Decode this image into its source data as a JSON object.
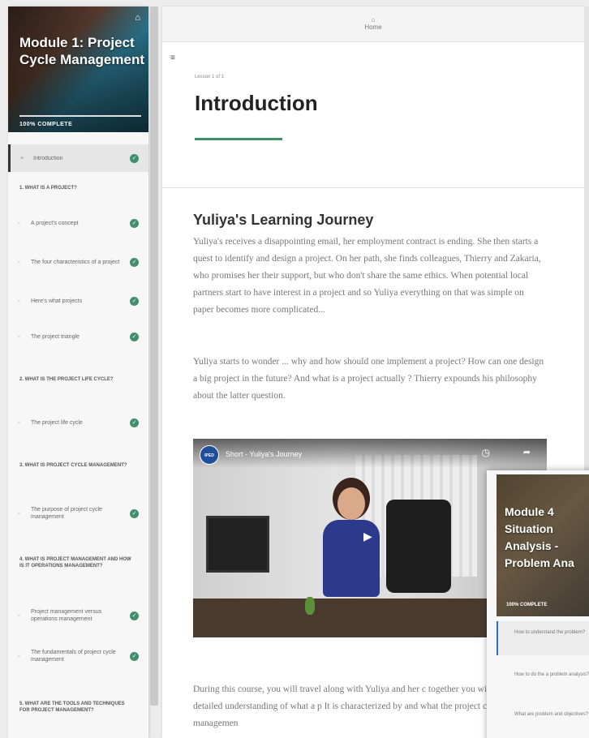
{
  "sidebar": {
    "hero_title": "Module 1: Project Cycle Management",
    "status": "100% COMPLETE",
    "items": [
      {
        "kind": "lesson",
        "label": "Introduction",
        "complete": true,
        "active": true
      },
      {
        "kind": "section",
        "label": "1. WHAT IS A PROJECT?"
      },
      {
        "kind": "lesson",
        "label": "A project's concept",
        "complete": true
      },
      {
        "kind": "lesson",
        "label": "The four characteristics of a project",
        "complete": true
      },
      {
        "kind": "lesson",
        "label": "Here's what projects",
        "complete": true
      },
      {
        "kind": "lesson",
        "label": "The project triangle",
        "complete": true
      },
      {
        "kind": "section",
        "label": "2. WHAT IS THE PROJECT LIFE CYCLE?"
      },
      {
        "kind": "lesson",
        "label": "The project life cycle",
        "complete": true
      },
      {
        "kind": "section",
        "label": "3. WHAT IS PROJECT CYCLE MANAGEMENT?"
      },
      {
        "kind": "lesson",
        "label": "The purpose of project cycle management",
        "complete": true
      },
      {
        "kind": "section",
        "label": "4. WHAT IS PROJECT MANAGEMENT AND HOW IS IT OPERATIONS MANAGEMENT?"
      },
      {
        "kind": "lesson",
        "label": "Project management versus operations management",
        "complete": true
      },
      {
        "kind": "lesson",
        "label": "The fundamentals of project cycle management",
        "complete": true
      },
      {
        "kind": "section",
        "label": "5. WHAT ARE THE TOOLS AND TECHNIQUES FOR PROJECT MANAGEMENT?"
      }
    ]
  },
  "topbar": {
    "home_label": "Home"
  },
  "main": {
    "breadcrumb": "Lesson 1 of 1",
    "title": "Introduction",
    "subheading": "Yuliya's Learning Journey",
    "paragraph1": "Yuliya's receives a disappointing email, her employment contract is ending. She then starts a quest to identify and design a project. On her path, she finds colleagues, Thierry and Zakaria, who promises her their support, but who don't share the same ethics. When potential local partners start to have interest in a project and so Yuliya everything on that was simple on paper becomes more complicated...",
    "paragraph2": "Yuliya starts to wonder ... why and how should one implement a project? How can one design a big project in the future? And what is a project actually ? Thierry expounds his philosophy about the latter question.",
    "paragraph3": "During this course, you will travel along with Yuliya and her c together you will acquire a detailed understanding of what a p It is characterized by and what the project cycle managemen",
    "video": {
      "channel_logo": "IPED",
      "title": "Short - Yuliya's Journey"
    }
  },
  "overlay_card": {
    "title_lines": [
      "Module 4",
      "Situation",
      "Analysis -",
      "Problem Ana"
    ],
    "status": "100% COMPLETE",
    "items": [
      "How to understand the problem?",
      "How to do the a problem analysis?",
      "What are problem and objectives?"
    ]
  },
  "colors": {
    "accent": "#3f8f6c",
    "check": "#3f8f6c",
    "active_border": "#2f6fb5"
  },
  "icons": [
    "home-icon",
    "hamburger-icon",
    "checkmark-icon",
    "lesson-icon",
    "play-icon",
    "share-icon",
    "clock-icon"
  ]
}
